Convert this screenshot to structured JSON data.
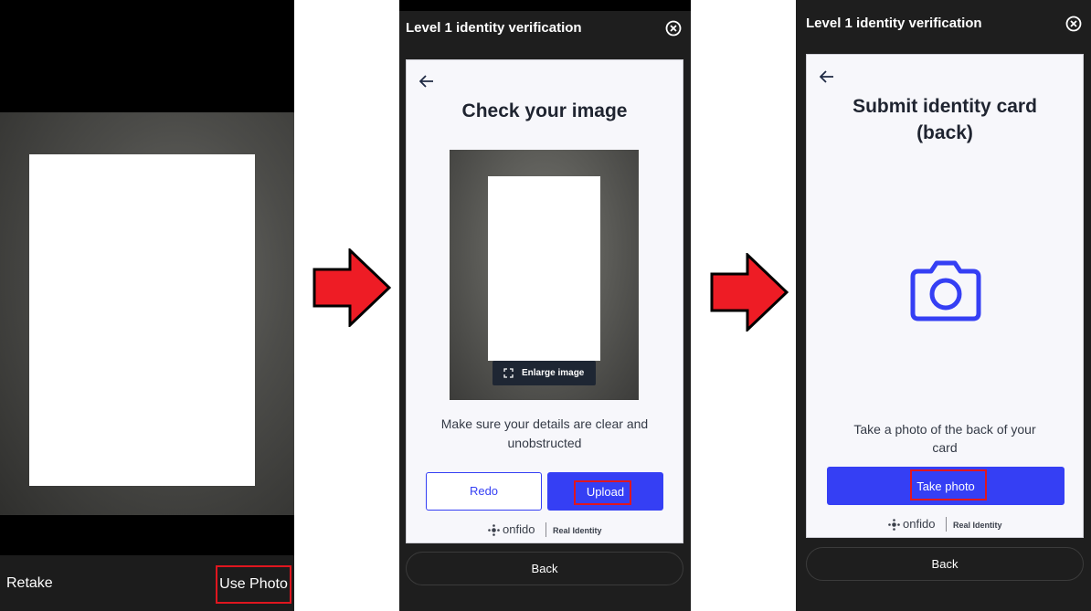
{
  "camera_screen": {
    "retake_label": "Retake",
    "use_photo_label": "Use Photo"
  },
  "check_image_screen": {
    "header_title": "Level 1 identity verification",
    "page_title": "Check your image",
    "enlarge_label": "Enlarge image",
    "instructions_line1": "Make sure your details are clear and",
    "instructions_line2": "unobstructed",
    "redo_label": "Redo",
    "upload_label": "Upload",
    "brand_name": "onfido",
    "brand_tagline": "Real Identity",
    "back_label": "Back"
  },
  "submit_card_screen": {
    "header_title": "Level 1 identity verification",
    "page_title_line1": "Submit identity card",
    "page_title_line2": "(back)",
    "instructions_line1": "Take a photo of the back of your",
    "instructions_line2": "card",
    "take_photo_label": "Take photo",
    "brand_name": "onfido",
    "brand_tagline": "Real Identity",
    "back_label": "Back"
  },
  "colors": {
    "accent": "#353ff4",
    "highlight": "#e0161f",
    "arrow_fill": "#ee1c25",
    "phone_bg": "#1e1e1e"
  },
  "icons": [
    "close-circle-icon",
    "back-arrow-icon",
    "enlarge-icon",
    "camera-icon",
    "onfido-logo-icon",
    "flow-arrow-icon"
  ]
}
